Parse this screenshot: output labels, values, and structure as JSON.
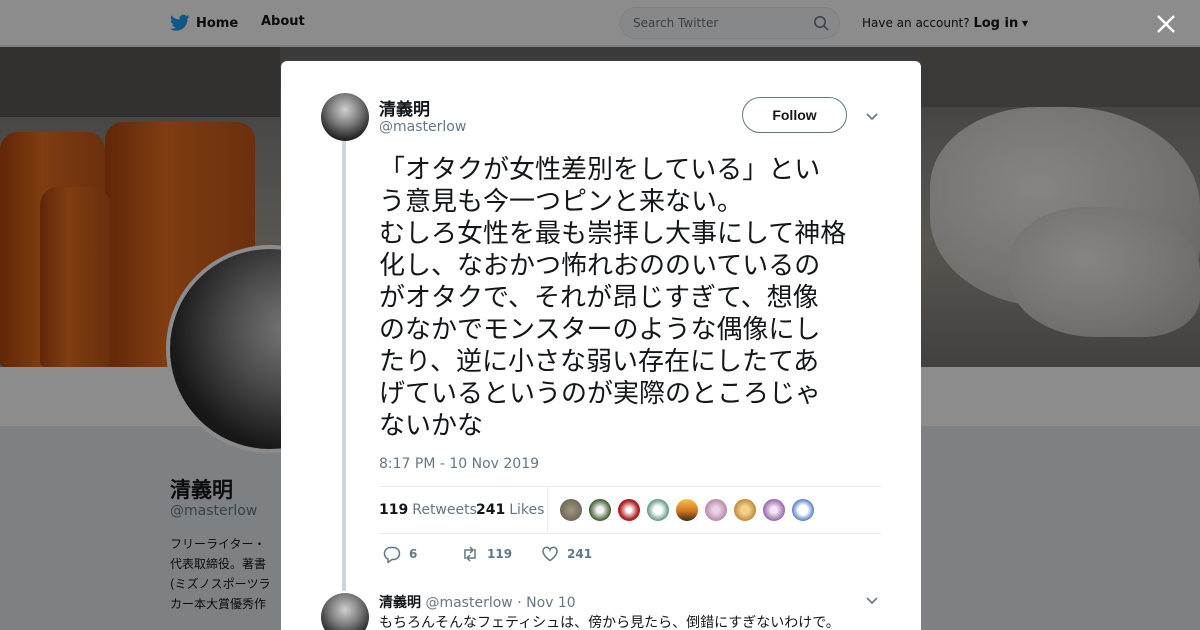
{
  "nav": {
    "home_label": "Home",
    "about_label": "About",
    "search_placeholder": "Search Twitter",
    "account_prompt": "Have an account?",
    "login_label": "Log in"
  },
  "profile": {
    "name": "清義明",
    "handle": "@masterlow",
    "bio": "フリーライター・\n代表取締役。著書\n(ミズノスポーツラ\nカー本大賞優秀作"
  },
  "tweet": {
    "author_name": "清義明",
    "author_handle": "@masterlow",
    "follow_label": "Follow",
    "text": "「オタクが女性差別をしている」とい\nう意見も今一つピンと来ない。\nむしろ女性を最も崇拝し大事にして神格\n化し、なおかつ怖れおののいているの\nがオタクで、それが昂じすぎて、想像\nのなかでモンスターのような偶像にし\nたり、逆に小さな弱い存在にしたてあ\nげているというのが実際のところじゃ\nないかな",
    "timestamp": "8:17 PM - 10 Nov 2019",
    "retweets_count": "119",
    "retweets_label": "Retweets",
    "likes_count": "241",
    "likes_label": "Likes",
    "reply_count": "6",
    "retweet_action_count": "119",
    "like_action_count": "241"
  },
  "reply": {
    "author_name": "清義明",
    "author_handle": "@masterlow",
    "date": "Nov 10",
    "separator": "·",
    "text": "もちろんそんなフェティシュは、傍から見たら、倒錯にすぎないわけで。"
  },
  "colors": {
    "brand": "#1da1f2",
    "text_primary": "#14171a",
    "text_secondary": "#657786"
  },
  "icons": [
    "twitter-bird-icon",
    "search-icon",
    "close-icon",
    "chevron-down-icon",
    "reply-icon",
    "retweet-icon",
    "like-icon"
  ]
}
